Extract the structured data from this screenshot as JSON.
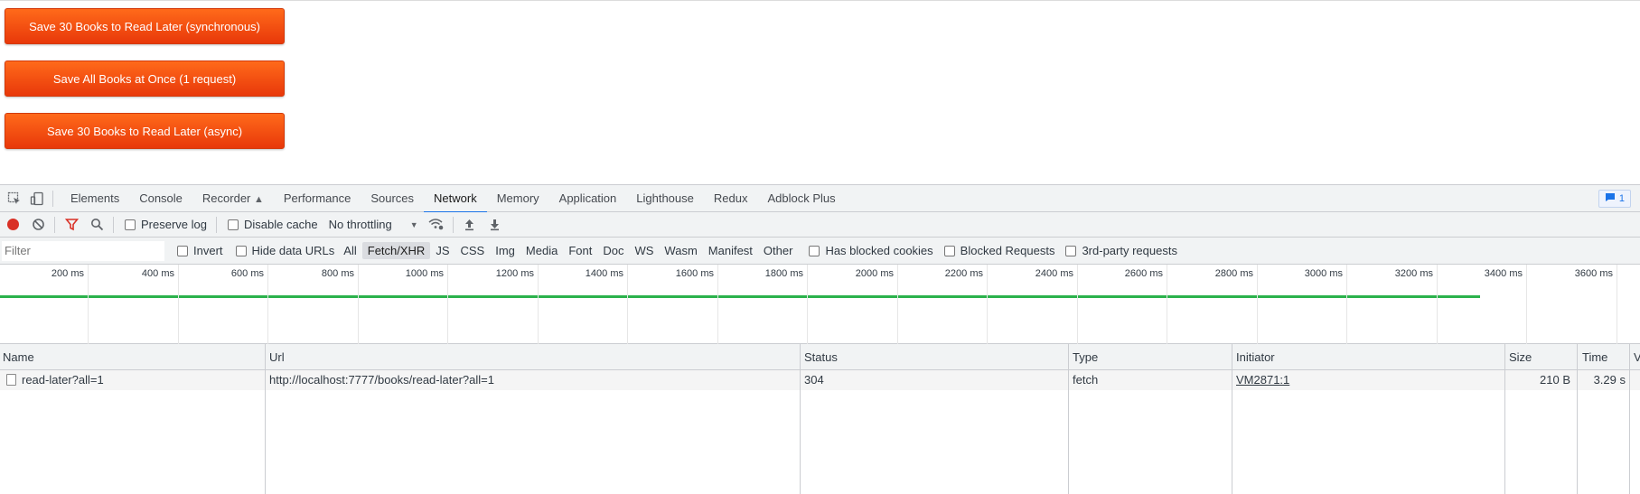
{
  "page": {
    "buttons": [
      "Save 30 Books to Read Later (synchronous)",
      "Save All Books at Once (1 request)",
      "Save 30 Books to Read Later (async)"
    ]
  },
  "devtools": {
    "tabs": [
      "Elements",
      "Console",
      "Recorder",
      "Performance",
      "Sources",
      "Network",
      "Memory",
      "Application",
      "Lighthouse",
      "Redux",
      "Adblock Plus"
    ],
    "active_tab": "Network",
    "messages_count": "1",
    "toolbar": {
      "preserve_log": "Preserve log",
      "disable_cache": "Disable cache",
      "throttling": "No throttling"
    },
    "filter": {
      "placeholder": "Filter",
      "invert": "Invert",
      "hide_data_urls": "Hide data URLs",
      "types": [
        "All",
        "Fetch/XHR",
        "JS",
        "CSS",
        "Img",
        "Media",
        "Font",
        "Doc",
        "WS",
        "Wasm",
        "Manifest",
        "Other"
      ],
      "active_type": "Fetch/XHR",
      "has_blocked_cookies": "Has blocked cookies",
      "blocked_requests": "Blocked Requests",
      "third_party": "3rd-party requests"
    },
    "overview": {
      "ticks": [
        "200 ms",
        "400 ms",
        "600 ms",
        "800 ms",
        "1000 ms",
        "1200 ms",
        "1400 ms",
        "1600 ms",
        "1800 ms",
        "2000 ms",
        "2200 ms",
        "2400 ms",
        "2600 ms",
        "2800 ms",
        "3000 ms",
        "3200 ms",
        "3400 ms",
        "3600 ms"
      ],
      "bar_color": "#2bb24c"
    },
    "table": {
      "headers": {
        "name": "Name",
        "url": "Url",
        "status": "Status",
        "type": "Type",
        "initiator": "Initiator",
        "size": "Size",
        "time": "Time",
        "waterfall": "V"
      },
      "rows": [
        {
          "name": "read-later?all=1",
          "url": "http://localhost:7777/books/read-later?all=1",
          "status": "304",
          "type": "fetch",
          "initiator": "VM2871:1",
          "size": "210 B",
          "time": "3.29 s"
        }
      ]
    }
  },
  "colors": {
    "button_top": "#ff6a1a",
    "button_bottom": "#e8380a",
    "accent": "#1a73e8",
    "record": "#d93025"
  }
}
